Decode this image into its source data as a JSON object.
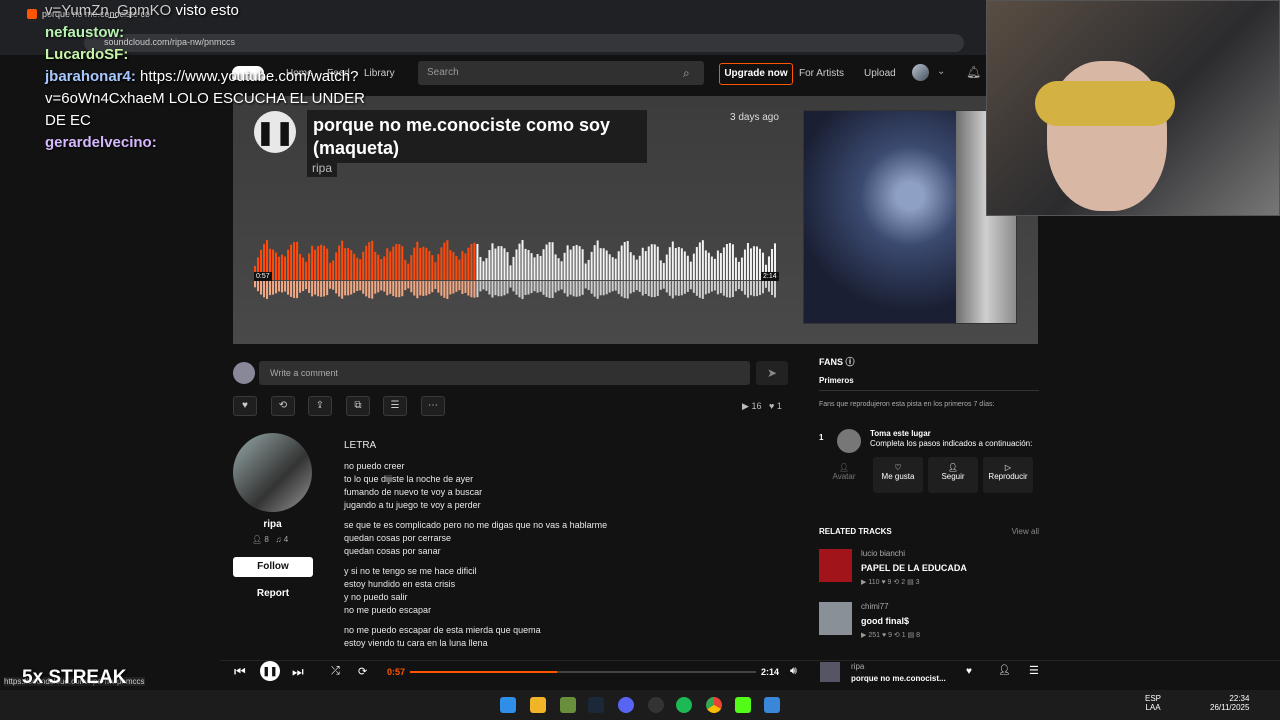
{
  "browser": {
    "tab_title": "porque no me.conociste co",
    "url": "soundcloud.com/ripa-nw/pnmccs",
    "status_url": "https://soundcloud.com/ripa-nw/pnmccs"
  },
  "nav": {
    "home": "Home",
    "feed": "Feed",
    "library": "Library",
    "search_placeholder": "Search",
    "upgrade": "Upgrade now",
    "for_artists": "For Artists",
    "upload": "Upload"
  },
  "track": {
    "title": "porque no me.conociste como soy (maqueta)",
    "artist": "ripa",
    "posted": "3 days ago",
    "elapsed": "0:57",
    "duration": "2:14",
    "progress": 0.425,
    "plays": "16",
    "likes": "1"
  },
  "comment": {
    "placeholder": "Write a comment"
  },
  "profile": {
    "name": "ripa",
    "followers": "8",
    "tracks": "4",
    "follow": "Follow",
    "report": "Report"
  },
  "lyrics": {
    "heading": "LETRA",
    "stanzas": [
      [
        "no puedo creer",
        "to lo que dijiste la noche de ayer",
        "fumando de nuevo te voy a buscar",
        "jugando a tu juego te voy a perder"
      ],
      [
        "se que te es complicado pero no me digas que no vas a hablarme",
        "quedan cosas por cerrarse",
        "quedan cosas por sanar"
      ],
      [
        "y si no te tengo se me hace dificil",
        "estoy hundido en esta crisis",
        "y no puedo salir",
        "no me puedo escapar"
      ],
      [
        "no me puedo escapar de esta mierda que quema",
        "estoy viendo tu cara en la luna llena"
      ]
    ]
  },
  "fans": {
    "title": "FANS",
    "tab": "Primeros",
    "desc": "Fans que reprodujeron esta pista en los primeros 7 días:",
    "rank": "1",
    "cta_title": "Toma este lugar",
    "cta_sub": "Completa los pasos indicados a continuación:",
    "avatar": "Avatar",
    "like": "Me gusta",
    "follow": "Seguir",
    "play": "Reproducir"
  },
  "related": {
    "title": "RELATED TRACKS",
    "view_all": "View all",
    "items": [
      {
        "artist": "lucio bianchi",
        "title": "PAPEL DE LA EDUCADA",
        "plays": "110",
        "likes": "9",
        "reposts": "2",
        "comments": "3"
      },
      {
        "artist": "chimi77",
        "title": "good final$",
        "plays": "251",
        "likes": "9",
        "reposts": "1",
        "comments": "8"
      }
    ]
  },
  "player": {
    "elapsed": "0:57",
    "duration": "2:14",
    "artist": "ripa",
    "title": "porque no me.conocist..."
  },
  "taskbar": {
    "lang": "ESP",
    "lang2": "LAA",
    "time": "22:34",
    "date": "26/11/2025"
  },
  "chat": [
    {
      "user": "v=YumZn_GpmKO",
      "text": "visto esto"
    },
    {
      "user": "nefaustow:",
      "text": ""
    },
    {
      "user": "LucardoSF:",
      "text": ""
    },
    {
      "user": "jbarahonar4:",
      "text": "https://www.youtube.com/watch?v=6oWn4CxhaeM LOLO ESCUCHA EL UNDER DE EC"
    },
    {
      "user": "gerardelvecino:",
      "text": ""
    }
  ],
  "overlay": {
    "streak": "5x STREAK"
  }
}
